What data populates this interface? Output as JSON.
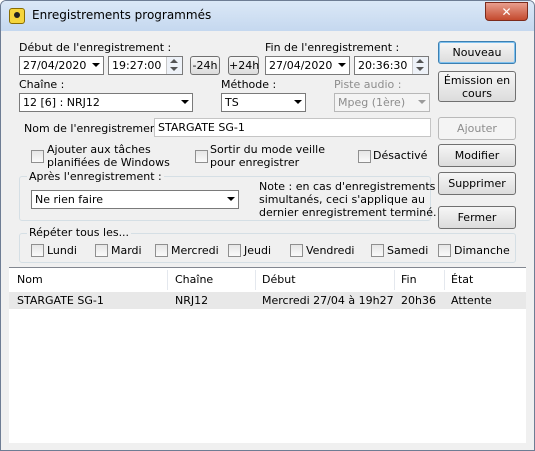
{
  "window": {
    "title": "Enregistrements programmés",
    "close_glyph": "✕"
  },
  "start": {
    "label": "Début de l'enregistrement :",
    "date": "27/04/2020",
    "time": "19:27:00",
    "minus_btn": "-24h",
    "plus_btn": "+24h"
  },
  "end": {
    "label": "Fin de l'enregistrement :",
    "date": "27/04/2020",
    "time": "20:36:30"
  },
  "channel": {
    "label": "Chaîne :",
    "value": "12 [6] : NRJ12"
  },
  "method": {
    "label": "Méthode :",
    "value": "TS"
  },
  "audio": {
    "label": "Piste audio :",
    "value": "Mpeg (1ère)"
  },
  "name": {
    "label": "Nom de l'enregistrement :",
    "value": "STARGATE SG-1"
  },
  "options": {
    "windows_tasks": [
      "Ajouter aux tâches",
      "planifiées de Windows"
    ],
    "wake": [
      "Sortir du mode veille",
      "pour enregistrer"
    ],
    "disabled": "Désactivé"
  },
  "after": {
    "title": "Après l'enregistrement :",
    "value": "Ne rien faire",
    "note": [
      "Note : en cas d'enregistrements",
      "simultanés, ceci s'applique au",
      "dernier enregistrement terminé."
    ]
  },
  "repeat": {
    "title": "Répéter tous les...",
    "days": [
      "Lundi",
      "Mardi",
      "Mercredi",
      "Jeudi",
      "Vendredi",
      "Samedi",
      "Dimanche"
    ]
  },
  "buttons": {
    "new": "Nouveau",
    "program": "Émission en\ncours",
    "add": "Ajouter",
    "modify": "Modifier",
    "delete": "Supprimer",
    "close": "Fermer"
  },
  "table": {
    "headers": [
      "Nom",
      "Chaîne",
      "Début",
      "Fin",
      "État"
    ],
    "rows": [
      [
        "STARGATE SG-1",
        "NRJ12",
        "Mercredi 27/04 à 19h27",
        "20h36",
        "Attente"
      ]
    ]
  }
}
